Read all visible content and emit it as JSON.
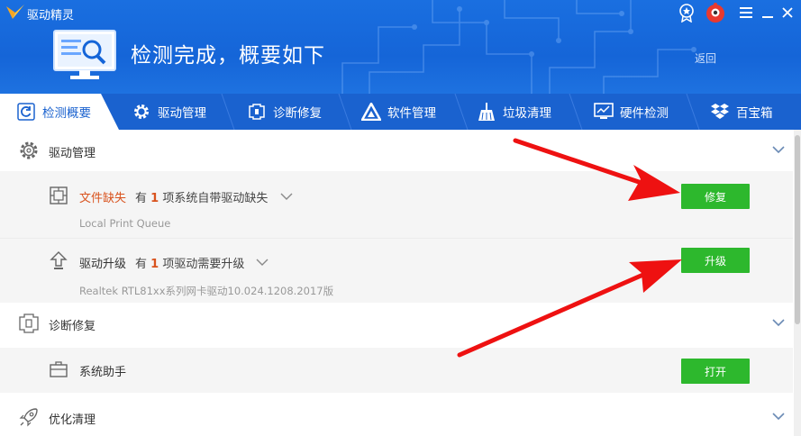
{
  "app": {
    "title": "驱动精灵"
  },
  "header": {
    "headline": "检测完成，概要如下",
    "back_label": "返回"
  },
  "tabs": [
    {
      "label": "检测概要",
      "icon": "refresh-icon",
      "active": true
    },
    {
      "label": "驱动管理",
      "icon": "gear-icon"
    },
    {
      "label": "诊断修复",
      "icon": "diagnose-icon"
    },
    {
      "label": "软件管理",
      "icon": "triangle-app-icon"
    },
    {
      "label": "垃圾清理",
      "icon": "broom-icon"
    },
    {
      "label": "硬件检测",
      "icon": "monitor-chart-icon"
    },
    {
      "label": "百宝箱",
      "icon": "dropbox-icon"
    }
  ],
  "sections": {
    "driver_mgmt": {
      "label": "驱动管理",
      "missing": {
        "title": "文件缺失",
        "desc_prefix": "有",
        "count": "1",
        "desc_suffix": "项系统自带驱动缺失",
        "sub": "Local Print Queue",
        "button": "修复"
      },
      "upgrade": {
        "title": "驱动升级",
        "desc_prefix": "有",
        "count": "1",
        "desc_suffix": "项驱动需要升级",
        "sub": "Realtek RTL81xx系列网卡驱动10.024.1208.2017版",
        "button": "升级"
      }
    },
    "diagnose": {
      "label": "诊断修复",
      "assistant": {
        "title": "系统助手",
        "button": "打开"
      }
    },
    "optimize": {
      "label": "优化清理"
    }
  },
  "colors": {
    "header_blue": "#1565d8",
    "tab_blue": "#1a62cf",
    "button_green": "#2db82d",
    "warn_orange": "#d9531e",
    "arrow_red": "#ee1111"
  }
}
